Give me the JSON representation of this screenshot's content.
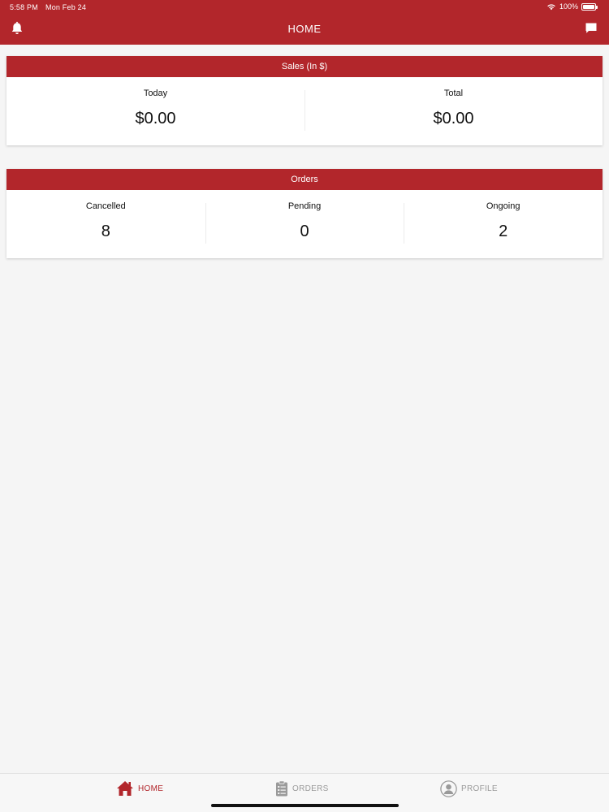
{
  "status_bar": {
    "time": "5:58 PM",
    "date": "Mon Feb 24",
    "battery": "100%"
  },
  "header": {
    "title": "HOME"
  },
  "sales": {
    "title": "Sales (In $)",
    "today_label": "Today",
    "today_value": "$0.00",
    "total_label": "Total",
    "total_value": "$0.00"
  },
  "orders": {
    "title": "Orders",
    "cancelled_label": "Cancelled",
    "cancelled_value": "8",
    "pending_label": "Pending",
    "pending_value": "0",
    "ongoing_label": "Ongoing",
    "ongoing_value": "2"
  },
  "tabbar": {
    "home_label": "HOME",
    "orders_label": "ORDERS",
    "profile_label": "PROFILE",
    "active": "home"
  },
  "colors": {
    "brand": "#b2262b",
    "inactive": "#9a9a9a",
    "background": "#f5f5f5"
  },
  "icons": [
    "bell-icon",
    "chat-icon",
    "wifi-icon",
    "battery-icon",
    "home-icon",
    "clipboard-icon",
    "user-icon"
  ]
}
